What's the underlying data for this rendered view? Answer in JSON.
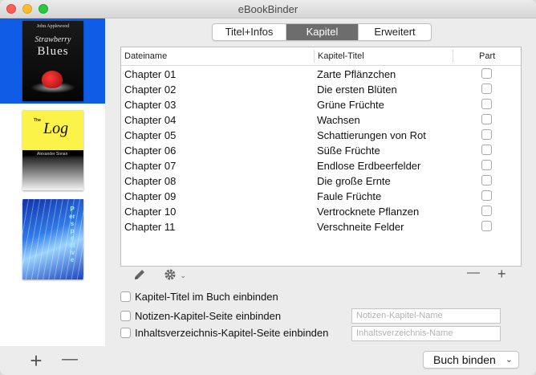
{
  "window": {
    "title": "eBookBinder"
  },
  "sidebar": {
    "books": [
      {
        "author": "John Applewood",
        "title_line1": "Strawberry",
        "title_line2": "Blues",
        "selected": true
      },
      {
        "the": "The",
        "title": "Log",
        "author": "Alexander Sonan",
        "selected": false
      },
      {
        "title": "Perspective",
        "selected": false
      }
    ],
    "add_label": "+",
    "remove_label": "—"
  },
  "tabs": [
    {
      "label": "Titel+Infos",
      "active": false
    },
    {
      "label": "Kapitel",
      "active": true
    },
    {
      "label": "Erweitert",
      "active": false
    }
  ],
  "table": {
    "headers": {
      "filename": "Dateiname",
      "chapter_title": "Kapitel-Titel",
      "part": "Part"
    },
    "rows": [
      {
        "filename": "Chapter 01",
        "title": "Zarte Pflänzchen",
        "part": false
      },
      {
        "filename": "Chapter 02",
        "title": "Die ersten Blüten",
        "part": false
      },
      {
        "filename": "Chapter 03",
        "title": "Grüne Früchte",
        "part": false
      },
      {
        "filename": "Chapter 04",
        "title": "Wachsen",
        "part": false
      },
      {
        "filename": "Chapter 05",
        "title": "Schattierungen von Rot",
        "part": false
      },
      {
        "filename": "Chapter 06",
        "title": "Süße Früchte",
        "part": false
      },
      {
        "filename": "Chapter 07",
        "title": "Endlose Erdbeerfelder",
        "part": false
      },
      {
        "filename": "Chapter 08",
        "title": "Die große Ernte",
        "part": false
      },
      {
        "filename": "Chapter 09",
        "title": "Faule Früchte",
        "part": false
      },
      {
        "filename": "Chapter 10",
        "title": "Vertrocknete Pflanzen",
        "part": false
      },
      {
        "filename": "Chapter 11",
        "title": "Verschneite Felder",
        "part": false
      }
    ]
  },
  "toolbar": {
    "minus_label": "—",
    "plus_label": "+"
  },
  "options": {
    "include_chapter_titles": "Kapitel-Titel im Buch einbinden",
    "include_notes_page": "Notizen-Kapitel-Seite einbinden",
    "include_toc_page": "Inhaltsverzeichnis-Kapitel-Seite einbinden",
    "notes_placeholder": "Notizen-Kapitel-Name",
    "toc_placeholder": "Inhaltsverzeichnis-Name"
  },
  "bind_button": {
    "label": "Buch binden"
  },
  "icons": [
    "pencil-icon",
    "gear-icon",
    "chevron-down-icon"
  ]
}
